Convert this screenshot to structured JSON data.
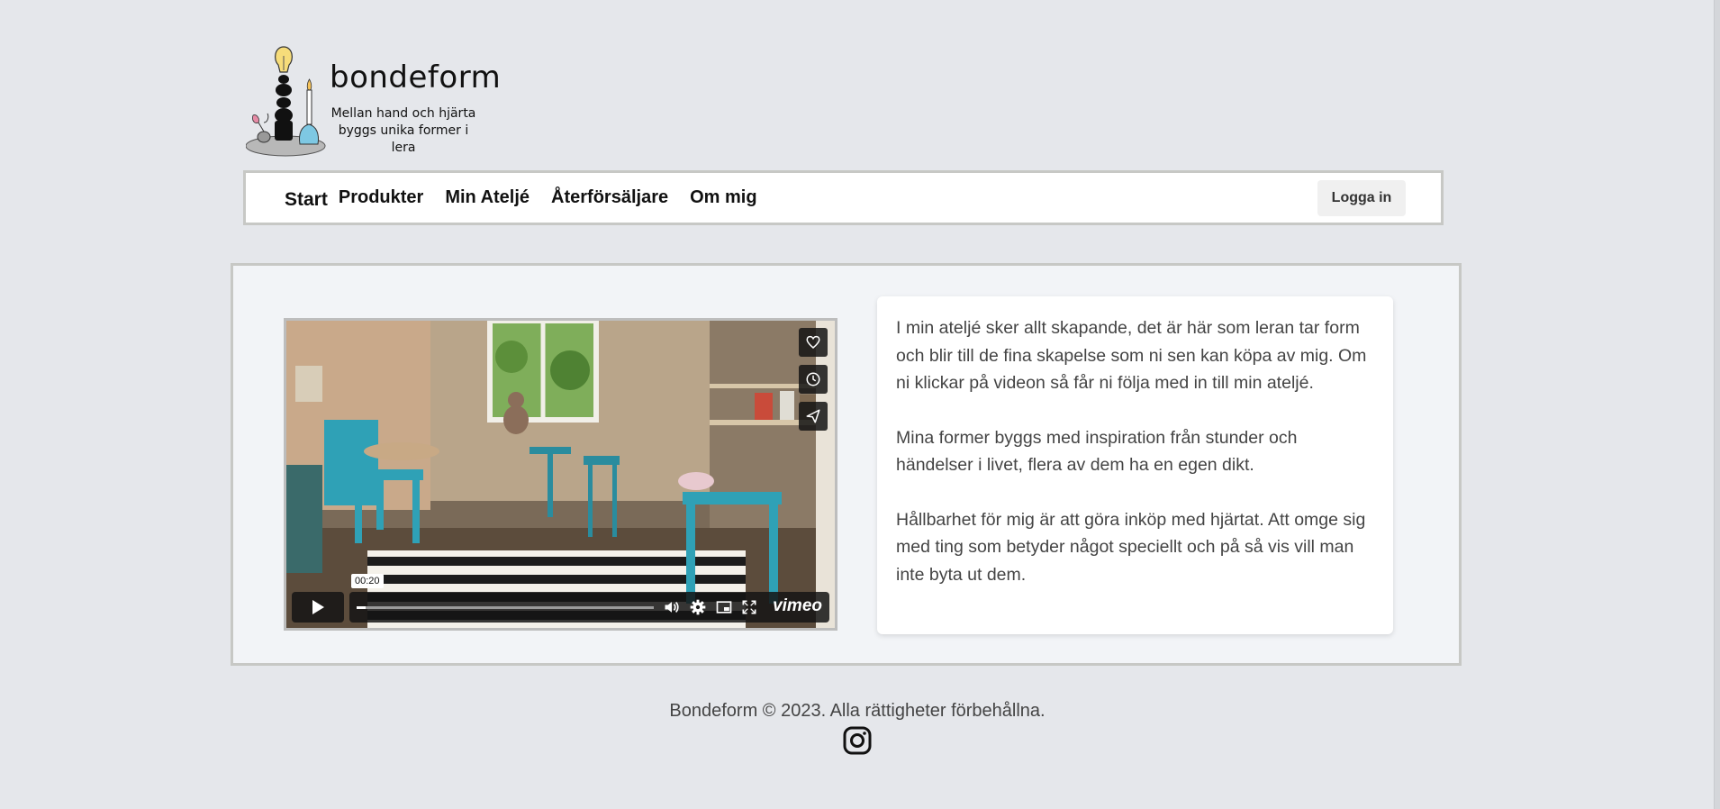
{
  "brand": {
    "name": "bondeform",
    "tagline_line1": "Mellan hand och hjärta",
    "tagline_line2": "byggs unika former i lera"
  },
  "nav": {
    "items": [
      {
        "label": "Start"
      },
      {
        "label": "Produkter"
      },
      {
        "label": "Min Ateljé"
      },
      {
        "label": "Återförsäljare"
      },
      {
        "label": "Om mig"
      }
    ],
    "login_label": "Logga in"
  },
  "video": {
    "time_tooltip": "00:20",
    "progress_fraction": 0.03,
    "provider_label": "vimeo",
    "side_icons": [
      "heart-icon",
      "clock-icon",
      "send-icon"
    ],
    "control_icons": [
      "volume-icon",
      "settings-icon",
      "pip-icon",
      "fullscreen-icon"
    ]
  },
  "content": {
    "paragraph1": "I min ateljé sker allt skapande, det är här som leran tar form och blir till de fina skapelse som ni sen kan köpa av mig. Om ni klickar på videon så får ni följa med in till min ateljé.",
    "paragraph2": "Mina former byggs med inspiration från stunder och händelser i livet, flera av dem ha en egen dikt.",
    "paragraph3": "Hållbarhet för mig är att göra inköp med hjärtat. Att omge sig med ting som betyder något speciellt och på så vis vill man inte byta ut dem."
  },
  "footer": {
    "copyright": "Bondeform © 2023. Alla rättigheter förbehållna.",
    "social_icon": "instagram-icon"
  },
  "colors": {
    "page_bg": "#e5e7eb",
    "panel_bg": "#f2f4f7",
    "border": "#c7c8c5",
    "text_muted": "#444444"
  }
}
